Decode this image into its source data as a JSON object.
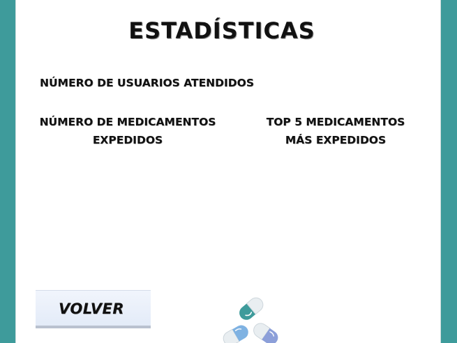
{
  "app": {
    "title": "ESTADÍSTICAS"
  },
  "stats": {
    "users_label": "NÚMERO DE USUARIOS ATENDIDOS",
    "meds_label_line1": "NÚMERO DE MEDICAMENTOS",
    "meds_label_line2": "EXPEDIDOS",
    "top5_label_line1": "TOP 5 MEDICAMENTOS",
    "top5_label_line2": "MÁS EXPEDIDOS"
  },
  "actions": {
    "back_label": "VOLVER"
  },
  "logo": {
    "icon": "pills-icon"
  },
  "colors": {
    "frame": "#3e9b9b",
    "panel": "#ffffff",
    "button": "#e3ebf8",
    "capsule_teal": "#3e9b9b",
    "capsule_blue": "#7fb2e2",
    "capsule_periwinkle": "#8c9fd9"
  }
}
